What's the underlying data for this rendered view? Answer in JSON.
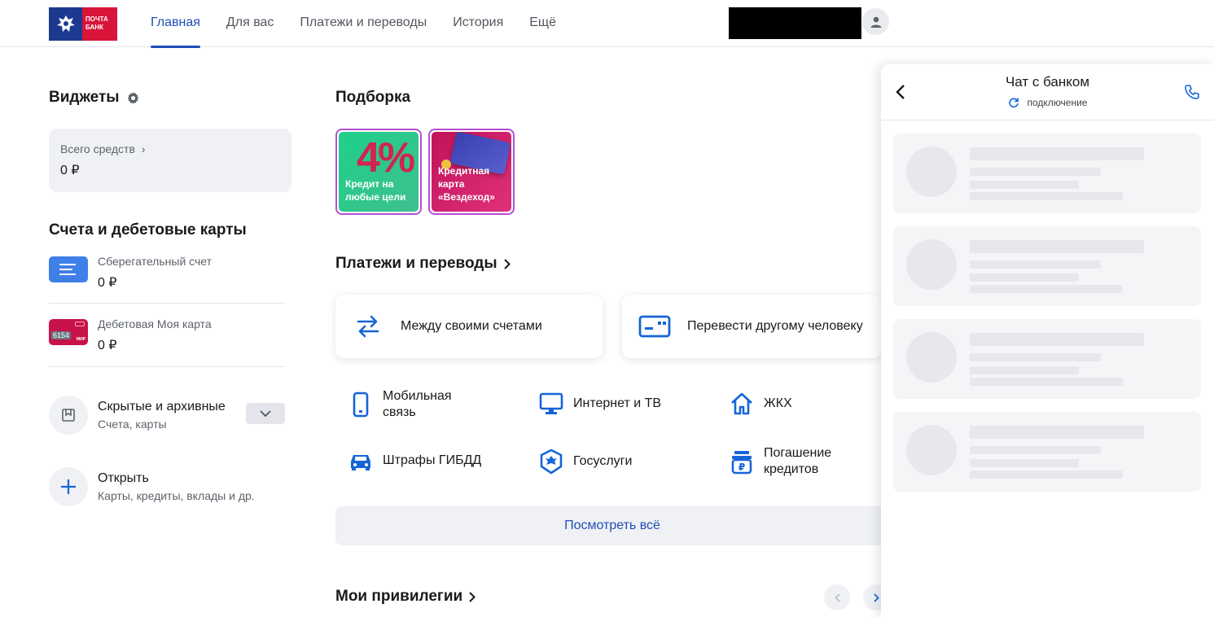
{
  "header": {
    "logo_text_line1": "ПОЧТА",
    "logo_text_line2": "БАНК",
    "nav": [
      "Главная",
      "Для вас",
      "Платежи и переводы",
      "История",
      "Ещё"
    ],
    "active_nav": "Главная"
  },
  "widgets": {
    "title": "Виджеты",
    "total_label": "Всего средств",
    "total_value": "0 ₽"
  },
  "accounts": {
    "title": "Счета и дебетовые карты",
    "items": [
      {
        "name": "Сберегательный счет",
        "balance": "0 ₽"
      },
      {
        "name": "Дебетовая Моя карта",
        "balance": "0 ₽",
        "card_number": "6154",
        "card_brand": "МИР"
      }
    ],
    "hidden": {
      "title": "Скрытые и архивные",
      "subtitle": "Счета, карты"
    },
    "open": {
      "title": "Открыть",
      "subtitle": "Карты, кредиты, вклады и др."
    }
  },
  "podborka": {
    "title": "Подборка",
    "promos": [
      {
        "big": "4%",
        "caption_line1": "Кредит на",
        "caption_line2": "любые цели"
      },
      {
        "caption_line1": "Кредитная",
        "caption_line2": "карта",
        "caption_line3": "«Вездеход»"
      }
    ]
  },
  "payments": {
    "title": "Платежи и переводы",
    "big_cards": [
      "Между своими счетами",
      "Перевести другому человеку"
    ],
    "services": [
      {
        "line1": "Мобильная",
        "line2": "связь",
        "icon": "phone-icon"
      },
      {
        "line1": "Интернет и ТВ",
        "line2": "",
        "icon": "monitor-icon"
      },
      {
        "line1": "ЖКХ",
        "line2": "",
        "icon": "home-icon"
      },
      {
        "line1": "Штрафы ГИБДД",
        "line2": "",
        "icon": "car-icon"
      },
      {
        "line1": "Госуслуги",
        "line2": "",
        "icon": "emblem-icon"
      },
      {
        "line1": "Погашение",
        "line2": "кредитов",
        "icon": "ruble-stack-icon"
      }
    ],
    "see_all": "Посмотреть всё"
  },
  "privileges": {
    "title": "Мои привилегии"
  },
  "chat": {
    "title": "Чат с банком",
    "status": "подключение"
  },
  "colors": {
    "accent": "#1f4fb5",
    "icon_blue": "#1565d8",
    "brand_red": "#d8143a",
    "brand_navy": "#1b3a8f"
  }
}
